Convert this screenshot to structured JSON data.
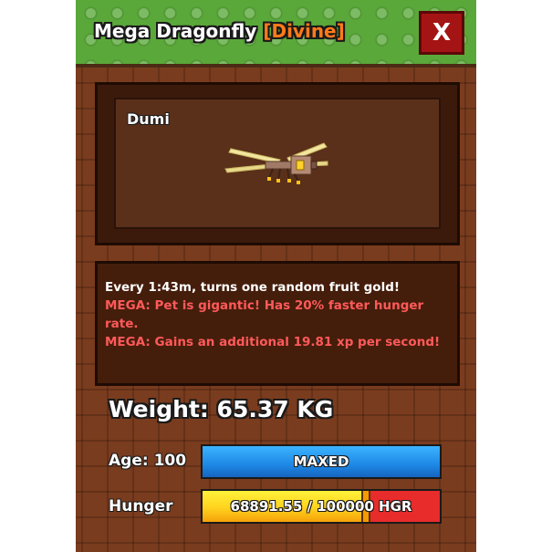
{
  "header": {
    "pet_title": "Mega Dragonfly",
    "rarity": "[Divine]",
    "close_label": "X"
  },
  "preview": {
    "pet_name": "Dumi"
  },
  "description": {
    "ability": "Every 1:43m, turns one random fruit gold!",
    "mega_hunger": "MEGA: Pet is gigantic! Has 20% faster hunger rate.",
    "mega_xp": "MEGA: Gains an additional 19.81 xp per second!"
  },
  "stats": {
    "weight_text": "Weight: 65.37 KG",
    "age_label": "Age: 100",
    "age_bar_text": "MAXED",
    "age_progress": 1.0,
    "hunger_label": "Hunger",
    "hunger_bar_text": "68891.55 / 100000 HGR",
    "hunger_progress": 0.6889
  },
  "colors": {
    "rarity": "#ff7a1a",
    "mega_text": "#ff5a5a",
    "age_bar": "#1e88e5",
    "hunger_fill": "#ffd21e",
    "hunger_empty": "#e82b2b"
  }
}
